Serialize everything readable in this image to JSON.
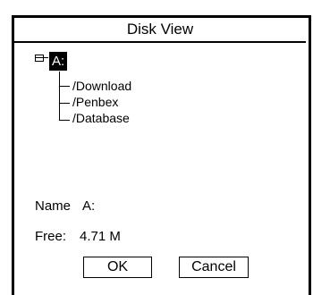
{
  "window": {
    "title": "Disk View"
  },
  "tree": {
    "drive_label": "A:",
    "folders": [
      "/Download",
      "/Penbex",
      "/Database"
    ]
  },
  "info": {
    "name_label": "Name",
    "name_value": "A:",
    "free_label": "Free:",
    "free_value": "4.71 M"
  },
  "buttons": {
    "ok_label": "OK",
    "cancel_label": "Cancel"
  }
}
